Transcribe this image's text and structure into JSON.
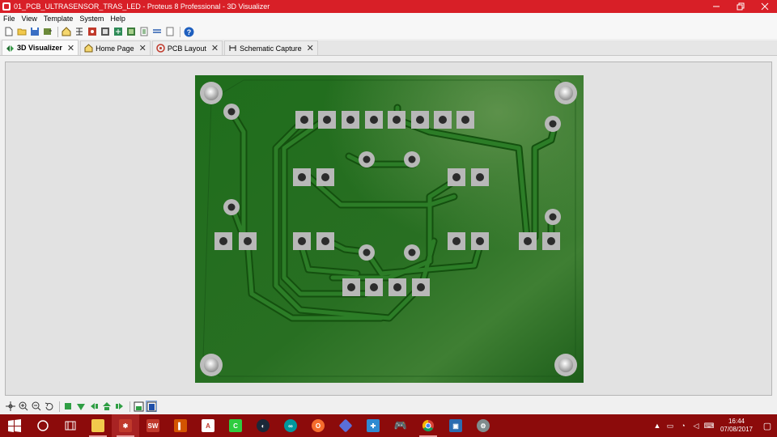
{
  "window": {
    "title": "01_PCB_ULTRASENSOR_TRAS_LED - Proteus 8 Professional - 3D Visualizer",
    "controls": [
      "minimize-icon",
      "restore-icon",
      "close-icon"
    ]
  },
  "menu": {
    "items": [
      {
        "label": "File"
      },
      {
        "label": "View"
      },
      {
        "label": "Template"
      },
      {
        "label": "System"
      },
      {
        "label": "Help"
      }
    ]
  },
  "toolbar": {
    "buttons": [
      "new-file-icon",
      "open-folder-icon",
      "save-icon",
      "import-icon",
      "home-icon",
      "schematic-icon",
      "pcb-icon",
      "bom-icon",
      "gerber-icon",
      "source-icon",
      "design-explorer-icon",
      "notes-icon",
      "help-icon"
    ]
  },
  "tabs": [
    {
      "label": "3D Visualizer",
      "icon": "3d-visualizer-icon",
      "active": true
    },
    {
      "label": "Home Page",
      "icon": "home-icon",
      "active": false
    },
    {
      "label": "PCB Layout",
      "icon": "pcb-layout-icon",
      "active": false
    },
    {
      "label": "Schematic Capture",
      "icon": "schematic-capture-icon",
      "active": false
    }
  ],
  "colors": {
    "titlebar": "#d81f27",
    "board_base": "#1f6b1d",
    "board_highlight": "#4e8a3c",
    "pad": "#bdbdbd",
    "taskbar": "#8c0b0b"
  },
  "bottom_toolbar": {
    "buttons": [
      "pan-icon",
      "zoom-in-icon",
      "zoom-out-icon",
      "rotate-icon",
      "top-view-icon",
      "bottom-view-icon",
      "left-view-icon",
      "front-view-icon",
      "right-view-icon",
      "fit-view-icon",
      "component-height-icon"
    ]
  },
  "taskbar": {
    "apps": [
      "cortana-icon",
      "task-view-icon",
      "file-explorer-icon",
      "proteus-icon",
      "solidworks-icon",
      "illustrator-like-icon",
      "autocad-icon",
      "camtasia-icon",
      "steam-icon",
      "arduino-icon",
      "origin-icon",
      "vs-like-icon",
      "ppsspp-icon",
      "gamepad-icon",
      "chrome-icon",
      "virtualbox-icon",
      "tools-icon"
    ],
    "time": "16:44",
    "date": "07/08/2017"
  }
}
